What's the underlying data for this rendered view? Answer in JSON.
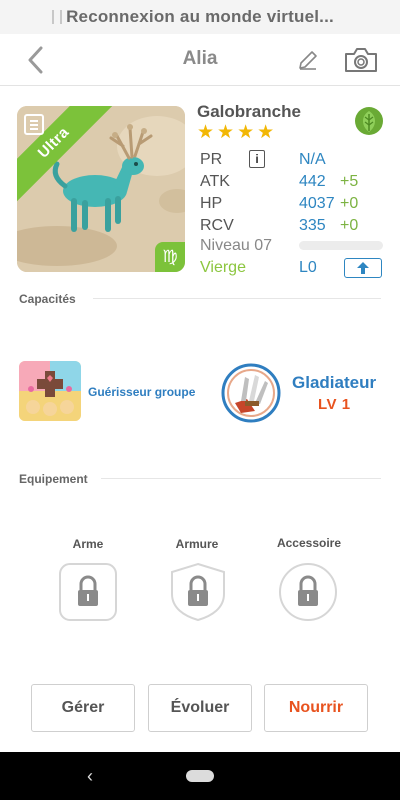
{
  "status": {
    "text": "Reconnexion au monde virtuel..."
  },
  "header": {
    "title": "Alia",
    "back_icon": "chevron-left-icon",
    "edit_icon": "pencil-icon",
    "camera_icon": "camera-icon"
  },
  "monster": {
    "rarity_label": "Ultra",
    "zodiac_symbol": "♍",
    "name": "Galobranche",
    "stars": 4,
    "element": "leaf",
    "element_color": "#6aaa35"
  },
  "stats": [
    {
      "label": "PR",
      "value": "N/A",
      "bonus": ""
    },
    {
      "label": "ATK",
      "value": "442",
      "bonus": "+5"
    },
    {
      "label": "HP",
      "value": "4037",
      "bonus": "+0"
    },
    {
      "label": "RCV",
      "value": "335",
      "bonus": "+0"
    }
  ],
  "level": {
    "label": "Niveau 07",
    "progress": 0.0
  },
  "zodiac": {
    "name": "Vierge",
    "rank": "L0"
  },
  "sections": {
    "abilities": "Capacités",
    "equipment": "Equipement"
  },
  "abilities": {
    "skill_name": "Guérisseur groupe",
    "class_name": "Gladiateur",
    "class_level": "LV 1"
  },
  "equipment": [
    {
      "label": "Arme"
    },
    {
      "label": "Armure"
    },
    {
      "label": "Accessoire"
    }
  ],
  "actions": {
    "manage": "Gérer",
    "evolve": "Évoluer",
    "feed": "Nourrir"
  },
  "colors": {
    "accent_blue": "#2e86c1",
    "bonus_green": "#7cb342",
    "feed_orange": "#e8531f",
    "rarity_green": "#7cc23a",
    "star_gold": "#f2b705"
  }
}
